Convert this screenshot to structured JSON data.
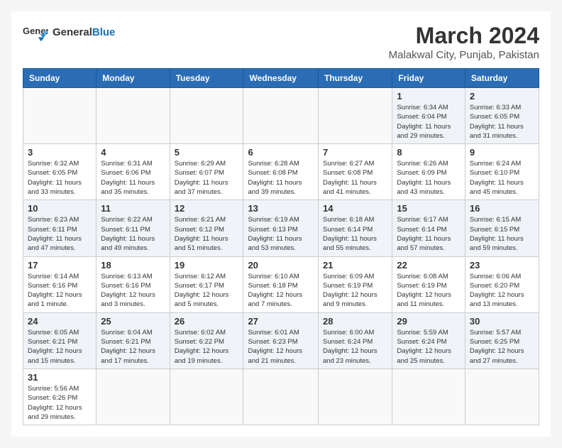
{
  "header": {
    "logo_general": "General",
    "logo_blue": "Blue",
    "title": "March 2024",
    "location": "Malakwal City, Punjab, Pakistan"
  },
  "days_of_week": [
    "Sunday",
    "Monday",
    "Tuesday",
    "Wednesday",
    "Thursday",
    "Friday",
    "Saturday"
  ],
  "weeks": [
    {
      "days": [
        {
          "num": "",
          "info": ""
        },
        {
          "num": "",
          "info": ""
        },
        {
          "num": "",
          "info": ""
        },
        {
          "num": "",
          "info": ""
        },
        {
          "num": "",
          "info": ""
        },
        {
          "num": "1",
          "info": "Sunrise: 6:34 AM\nSunset: 6:04 PM\nDaylight: 11 hours\nand 29 minutes."
        },
        {
          "num": "2",
          "info": "Sunrise: 6:33 AM\nSunset: 6:05 PM\nDaylight: 11 hours\nand 31 minutes."
        }
      ]
    },
    {
      "days": [
        {
          "num": "3",
          "info": "Sunrise: 6:32 AM\nSunset: 6:05 PM\nDaylight: 11 hours\nand 33 minutes."
        },
        {
          "num": "4",
          "info": "Sunrise: 6:31 AM\nSunset: 6:06 PM\nDaylight: 11 hours\nand 35 minutes."
        },
        {
          "num": "5",
          "info": "Sunrise: 6:29 AM\nSunset: 6:07 PM\nDaylight: 11 hours\nand 37 minutes."
        },
        {
          "num": "6",
          "info": "Sunrise: 6:28 AM\nSunset: 6:08 PM\nDaylight: 11 hours\nand 39 minutes."
        },
        {
          "num": "7",
          "info": "Sunrise: 6:27 AM\nSunset: 6:08 PM\nDaylight: 11 hours\nand 41 minutes."
        },
        {
          "num": "8",
          "info": "Sunrise: 6:26 AM\nSunset: 6:09 PM\nDaylight: 11 hours\nand 43 minutes."
        },
        {
          "num": "9",
          "info": "Sunrise: 6:24 AM\nSunset: 6:10 PM\nDaylight: 11 hours\nand 45 minutes."
        }
      ]
    },
    {
      "days": [
        {
          "num": "10",
          "info": "Sunrise: 6:23 AM\nSunset: 6:11 PM\nDaylight: 11 hours\nand 47 minutes."
        },
        {
          "num": "11",
          "info": "Sunrise: 6:22 AM\nSunset: 6:11 PM\nDaylight: 11 hours\nand 49 minutes."
        },
        {
          "num": "12",
          "info": "Sunrise: 6:21 AM\nSunset: 6:12 PM\nDaylight: 11 hours\nand 51 minutes."
        },
        {
          "num": "13",
          "info": "Sunrise: 6:19 AM\nSunset: 6:13 PM\nDaylight: 11 hours\nand 53 minutes."
        },
        {
          "num": "14",
          "info": "Sunrise: 6:18 AM\nSunset: 6:14 PM\nDaylight: 11 hours\nand 55 minutes."
        },
        {
          "num": "15",
          "info": "Sunrise: 6:17 AM\nSunset: 6:14 PM\nDaylight: 11 hours\nand 57 minutes."
        },
        {
          "num": "16",
          "info": "Sunrise: 6:15 AM\nSunset: 6:15 PM\nDaylight: 11 hours\nand 59 minutes."
        }
      ]
    },
    {
      "days": [
        {
          "num": "17",
          "info": "Sunrise: 6:14 AM\nSunset: 6:16 PM\nDaylight: 12 hours\nand 1 minute."
        },
        {
          "num": "18",
          "info": "Sunrise: 6:13 AM\nSunset: 6:16 PM\nDaylight: 12 hours\nand 3 minutes."
        },
        {
          "num": "19",
          "info": "Sunrise: 6:12 AM\nSunset: 6:17 PM\nDaylight: 12 hours\nand 5 minutes."
        },
        {
          "num": "20",
          "info": "Sunrise: 6:10 AM\nSunset: 6:18 PM\nDaylight: 12 hours\nand 7 minutes."
        },
        {
          "num": "21",
          "info": "Sunrise: 6:09 AM\nSunset: 6:19 PM\nDaylight: 12 hours\nand 9 minutes."
        },
        {
          "num": "22",
          "info": "Sunrise: 6:08 AM\nSunset: 6:19 PM\nDaylight: 12 hours\nand 11 minutes."
        },
        {
          "num": "23",
          "info": "Sunrise: 6:06 AM\nSunset: 6:20 PM\nDaylight: 12 hours\nand 13 minutes."
        }
      ]
    },
    {
      "days": [
        {
          "num": "24",
          "info": "Sunrise: 6:05 AM\nSunset: 6:21 PM\nDaylight: 12 hours\nand 15 minutes."
        },
        {
          "num": "25",
          "info": "Sunrise: 6:04 AM\nSunset: 6:21 PM\nDaylight: 12 hours\nand 17 minutes."
        },
        {
          "num": "26",
          "info": "Sunrise: 6:02 AM\nSunset: 6:22 PM\nDaylight: 12 hours\nand 19 minutes."
        },
        {
          "num": "27",
          "info": "Sunrise: 6:01 AM\nSunset: 6:23 PM\nDaylight: 12 hours\nand 21 minutes."
        },
        {
          "num": "28",
          "info": "Sunrise: 6:00 AM\nSunset: 6:24 PM\nDaylight: 12 hours\nand 23 minutes."
        },
        {
          "num": "29",
          "info": "Sunrise: 5:59 AM\nSunset: 6:24 PM\nDaylight: 12 hours\nand 25 minutes."
        },
        {
          "num": "30",
          "info": "Sunrise: 5:57 AM\nSunset: 6:25 PM\nDaylight: 12 hours\nand 27 minutes."
        }
      ]
    },
    {
      "days": [
        {
          "num": "31",
          "info": "Sunrise: 5:56 AM\nSunset: 6:26 PM\nDaylight: 12 hours\nand 29 minutes."
        },
        {
          "num": "",
          "info": ""
        },
        {
          "num": "",
          "info": ""
        },
        {
          "num": "",
          "info": ""
        },
        {
          "num": "",
          "info": ""
        },
        {
          "num": "",
          "info": ""
        },
        {
          "num": "",
          "info": ""
        }
      ]
    }
  ]
}
